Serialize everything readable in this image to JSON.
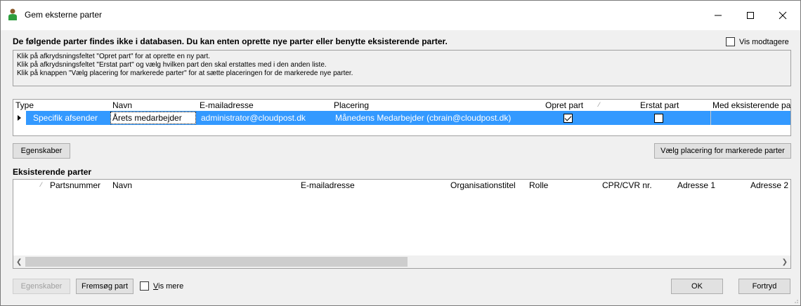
{
  "window": {
    "title": "Gem eksterne parter",
    "icon": "person-icon",
    "controls": [
      "minimize",
      "maximize",
      "close"
    ]
  },
  "header": {
    "text": "De følgende parter findes ikke i databasen.  Du kan enten oprette nye parter eller benytte eksisterende parter.",
    "vis_modtagere_label": "Vis modtagere",
    "vis_modtagere_checked": false
  },
  "info": {
    "lines": [
      "Klik på afkrydsningsfeltet \"Opret part\" for at oprette en ny part.",
      "Klik på afkrydsningsfeltet \"Erstat part\" og vælg hvilken part den skal erstattes med i den anden liste.",
      "Klik på knappen \"Vælg placering for markerede parter\" for at sætte placeringen for de markerede nye parter."
    ]
  },
  "new_parties": {
    "columns": [
      "Type",
      "Navn",
      "E-mailadresse",
      "Placering",
      "Opret part",
      "Erstat part",
      "Med eksisterende pa"
    ],
    "rows": [
      {
        "type": "Specifik afsender",
        "navn": "Årets medarbejder",
        "email": "administrator@cloudpost.dk",
        "placering": "Månedens Medarbejder (cbrain@cloudpost.dk)",
        "opret_part": true,
        "erstat_part": false,
        "med_eksisterende": ""
      }
    ]
  },
  "buttons": {
    "egenskaber_top": "Egenskaber",
    "vaelg_placering": "Vælg placering for markerede parter",
    "egenskaber_bottom": "Egenskaber",
    "fremsoeg_part": "Fremsøg part",
    "ok": "OK",
    "fortryd": "Fortryd"
  },
  "existing_parties": {
    "label": "Eksisterende parter",
    "columns": [
      "Partsnummer",
      "Navn",
      "E-mailadresse",
      "Organisationstitel",
      "Rolle",
      "CPR/CVR nr.",
      "Adresse 1",
      "Adresse 2"
    ],
    "rows": []
  },
  "vis_mere": {
    "label": "Vis mere",
    "checked": false
  },
  "colors": {
    "selection": "#3399ff",
    "window_bg": "#f0f0f0"
  }
}
